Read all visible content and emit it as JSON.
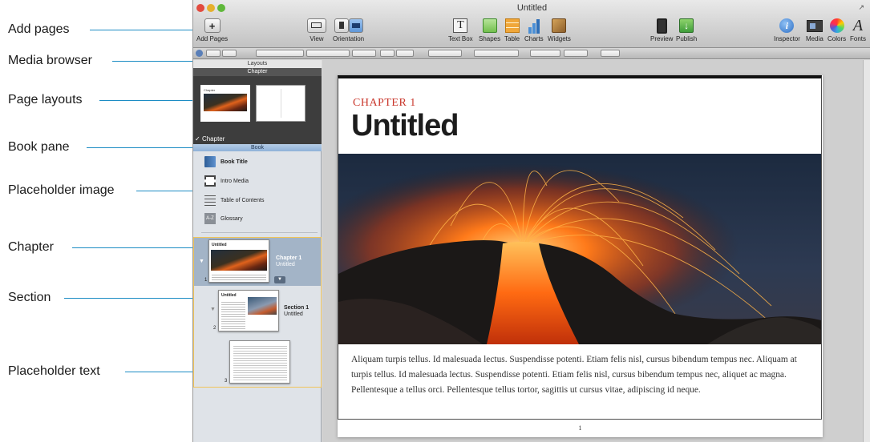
{
  "callouts": {
    "add_pages": "Add pages",
    "media_browser": "Media browser",
    "page_layouts": "Page layouts",
    "book_pane": "Book pane",
    "placeholder_image": "Placeholder image",
    "chapter": "Chapter",
    "section": "Section",
    "placeholder_text": "Placeholder text"
  },
  "colors": {
    "callout_line": "#1c8cc4",
    "chapter_label": "#c9352a",
    "selection_border": "#f0c45a",
    "book_header": "#8fb1d8"
  },
  "window": {
    "title": "Untitled"
  },
  "toolbar": {
    "add_pages": "Add Pages",
    "view": "View",
    "orientation": "Orientation",
    "text_box": "Text Box",
    "shapes": "Shapes",
    "table": "Table",
    "charts": "Charts",
    "widgets": "Widgets",
    "preview": "Preview",
    "publish": "Publish",
    "inspector": "Inspector",
    "media": "Media",
    "colors": "Colors",
    "fonts": "Fonts"
  },
  "toolbar_icons": {
    "add_pages": "plus-icon",
    "view": "view-icon",
    "orientation": "orientation-icon",
    "text_box": "text-box-icon",
    "shapes": "shapes-icon",
    "table": "table-icon",
    "charts": "chart-icon",
    "widgets": "widget-icon",
    "preview": "preview-device-icon",
    "publish": "publish-icon",
    "inspector": "info-icon",
    "media": "media-icon",
    "colors": "color-wheel-icon",
    "fonts": "fonts-icon"
  },
  "sidebar": {
    "layouts_header": "Layouts",
    "layouts_title": "Chapter",
    "selected_layout": "Chapter",
    "layout_thumb_title": "Chapter",
    "book_header": "Book",
    "book_items": [
      {
        "label": "Book Title",
        "icon": "book-icon"
      },
      {
        "label": "Intro Media",
        "icon": "film-icon"
      },
      {
        "label": "Table of Contents",
        "icon": "list-icon"
      },
      {
        "label": "Glossary",
        "icon": "glossary-icon"
      }
    ],
    "chapter": {
      "number": "1",
      "title": "Chapter 1",
      "subtitle": "Untitled",
      "thumb_title": "Untitled"
    },
    "section": {
      "number": "2",
      "title": "Section 1",
      "subtitle": "Untitled",
      "thumb_title": "Untitled"
    },
    "page3": {
      "number": "3"
    }
  },
  "document": {
    "chapter_label": "CHAPTER 1",
    "chapter_title": "Untitled",
    "body_text": "Aliquam turpis tellus. Id malesuada lectus. Suspendisse potenti. Etiam felis nisl, cursus bibendum tempus nec. Aliquam at turpis tellus. Id malesuada lectus. Suspendisse potenti. Etiam felis nisl, cursus bibendum tempus nec, aliquet ac magna. Pellentesque a tellus orci. Pellentesque tellus tortor, sagittis ut cursus vitae, adipiscing id neque.",
    "page_number": "1"
  }
}
